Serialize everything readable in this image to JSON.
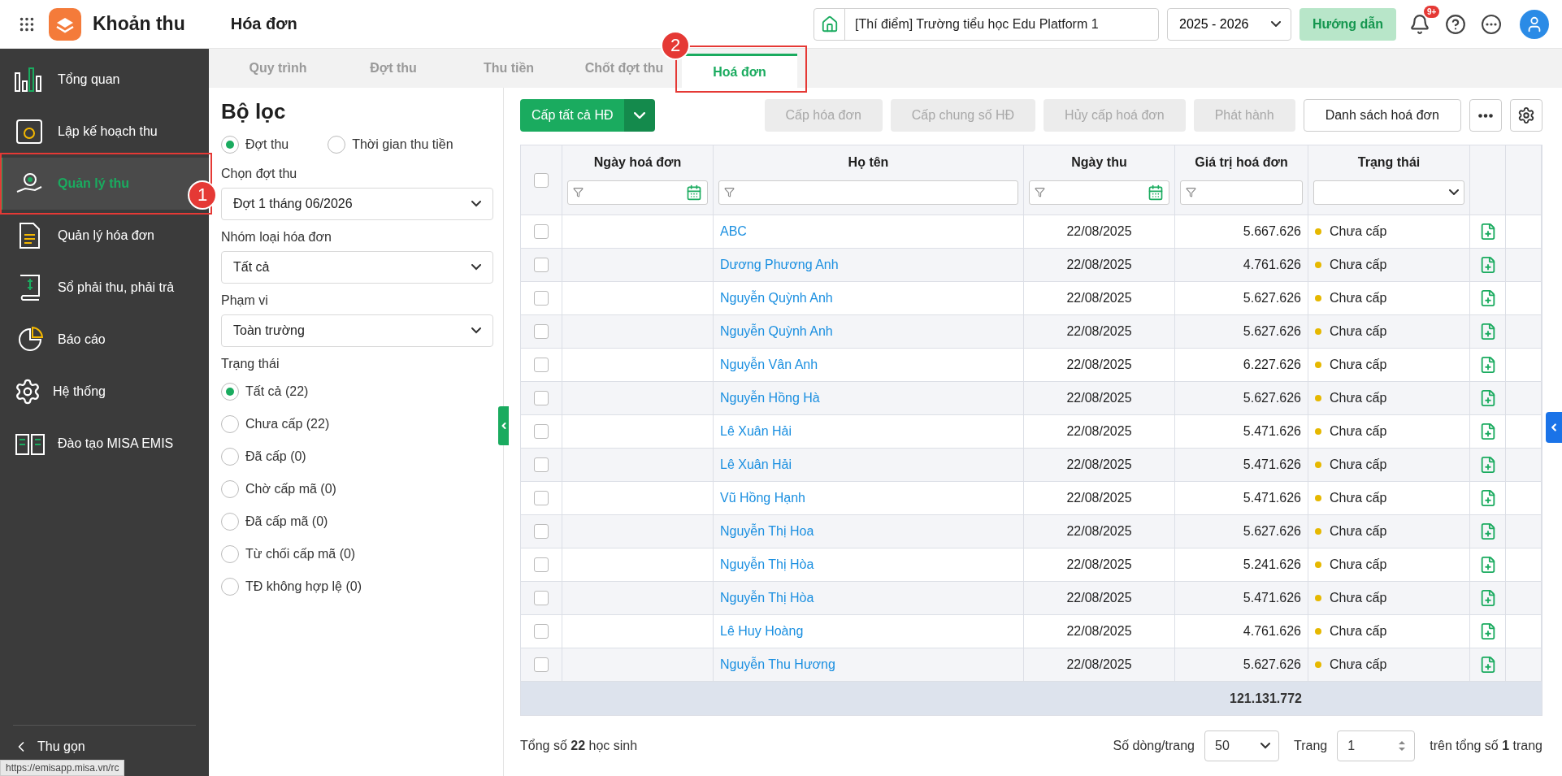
{
  "app": {
    "title": "Khoản thu",
    "page_title": "Hóa đơn",
    "school": "[Thí điểm] Trường tiểu học Edu Platform 1",
    "year": "2025 - 2026",
    "guide_button": "Hướng dẫn",
    "notification_badge": "9+"
  },
  "sidebar": {
    "items": [
      {
        "label": "Tổng quan",
        "selected": false
      },
      {
        "label": "Lập kế hoạch thu",
        "selected": false
      },
      {
        "label": "Quản lý thu",
        "selected": true,
        "callout": "1"
      },
      {
        "label": "Quản lý hóa đơn",
        "selected": false
      },
      {
        "label": "Sổ phải thu, phải trả",
        "selected": false
      },
      {
        "label": "Báo cáo",
        "selected": false
      },
      {
        "label": "Hệ thống",
        "selected": false
      },
      {
        "label": "Đào tạo MISA EMIS",
        "selected": false
      }
    ],
    "collapse": "Thu gọn"
  },
  "tabs": [
    {
      "label": "Quy trình",
      "selected": false
    },
    {
      "label": "Đợt thu",
      "selected": false
    },
    {
      "label": "Thu tiền",
      "selected": false
    },
    {
      "label": "Chốt đợt thu",
      "selected": false
    },
    {
      "label": "Hoá đơn",
      "selected": true,
      "callout": "2"
    }
  ],
  "filter": {
    "title": "Bộ lọc",
    "modes": [
      {
        "label": "Đợt thu",
        "selected": true
      },
      {
        "label": "Thời gian thu tiền",
        "selected": false
      }
    ],
    "fields": [
      {
        "label": "Chọn đợt thu",
        "value": "Đợt 1 tháng 06/2026"
      },
      {
        "label": "Nhóm loại hóa đơn",
        "value": "Tất cả"
      },
      {
        "label": "Phạm vi",
        "value": "Toàn trường"
      }
    ],
    "status_label": "Trạng thái",
    "statuses": [
      {
        "label": "Tất cả (22)",
        "selected": true
      },
      {
        "label": "Chưa cấp (22)",
        "selected": false
      },
      {
        "label": "Đã cấp (0)",
        "selected": false
      },
      {
        "label": "Chờ cấp mã (0)",
        "selected": false
      },
      {
        "label": "Đã cấp mã (0)",
        "selected": false
      },
      {
        "label": "Từ chối cấp mã (0)",
        "selected": false
      },
      {
        "label": "TĐ không hợp lệ (0)",
        "selected": false
      }
    ]
  },
  "toolbar": {
    "primary": "Cấp tất cả HĐ",
    "buttons": [
      {
        "label": "Cấp hóa đơn",
        "disabled": true
      },
      {
        "label": "Cấp chung số HĐ",
        "disabled": true
      },
      {
        "label": "Hủy cấp hoá đơn",
        "disabled": true
      },
      {
        "label": "Phát hành",
        "disabled": true
      },
      {
        "label": "Danh sách hoá đơn",
        "disabled": false
      }
    ]
  },
  "table": {
    "columns": [
      {
        "label": "Ngày hoá đơn",
        "kind": "date"
      },
      {
        "label": "Họ tên",
        "kind": "text"
      },
      {
        "label": "Ngày thu",
        "kind": "date"
      },
      {
        "label": "Giá trị hoá đơn",
        "kind": "text"
      },
      {
        "label": "Trạng thái",
        "kind": "select"
      }
    ],
    "select_all_checked": false,
    "rows": [
      {
        "checked": false,
        "name": "ABC",
        "date": "22/08/2025",
        "amount": "5.667.626",
        "status": "Chưa cấp"
      },
      {
        "checked": false,
        "name": "Dương Phương Anh",
        "date": "22/08/2025",
        "amount": "4.761.626",
        "status": "Chưa cấp"
      },
      {
        "checked": false,
        "name": "Nguyễn Quỳnh Anh",
        "date": "22/08/2025",
        "amount": "5.627.626",
        "status": "Chưa cấp"
      },
      {
        "checked": false,
        "name": "Nguyễn Quỳnh Anh",
        "date": "22/08/2025",
        "amount": "5.627.626",
        "status": "Chưa cấp"
      },
      {
        "checked": false,
        "name": "Nguyễn Vân Anh",
        "date": "22/08/2025",
        "amount": "6.227.626",
        "status": "Chưa cấp"
      },
      {
        "checked": false,
        "name": "Nguyễn Hồng Hà",
        "date": "22/08/2025",
        "amount": "5.627.626",
        "status": "Chưa cấp"
      },
      {
        "checked": false,
        "name": "Lê Xuân Hải",
        "date": "22/08/2025",
        "amount": "5.471.626",
        "status": "Chưa cấp"
      },
      {
        "checked": false,
        "name": "Lê Xuân Hải",
        "date": "22/08/2025",
        "amount": "5.471.626",
        "status": "Chưa cấp"
      },
      {
        "checked": false,
        "name": "Vũ Hồng Hạnh",
        "date": "22/08/2025",
        "amount": "5.471.626",
        "status": "Chưa cấp"
      },
      {
        "checked": false,
        "name": "Nguyễn Thị Hoa",
        "date": "22/08/2025",
        "amount": "5.627.626",
        "status": "Chưa cấp"
      },
      {
        "checked": false,
        "name": "Nguyễn Thị Hòa",
        "date": "22/08/2025",
        "amount": "5.241.626",
        "status": "Chưa cấp"
      },
      {
        "checked": false,
        "name": "Nguyễn Thị Hòa",
        "date": "22/08/2025",
        "amount": "5.471.626",
        "status": "Chưa cấp"
      },
      {
        "checked": false,
        "name": "Lê Huy Hoàng",
        "date": "22/08/2025",
        "amount": "4.761.626",
        "status": "Chưa cấp"
      },
      {
        "checked": false,
        "name": "Nguyễn Thu Hương",
        "date": "22/08/2025",
        "amount": "5.627.626",
        "status": "Chưa cấp"
      }
    ],
    "total": "121.131.772"
  },
  "footer": {
    "summary": "Tổng số **22** học sinh",
    "page_size_label": "Số dòng/trang",
    "page_size": "50",
    "page_label": "Trang",
    "page": "1",
    "page_total": "trên tổng số **1** trang"
  },
  "status_url": "https://emisapp.misa.vn/rc"
}
